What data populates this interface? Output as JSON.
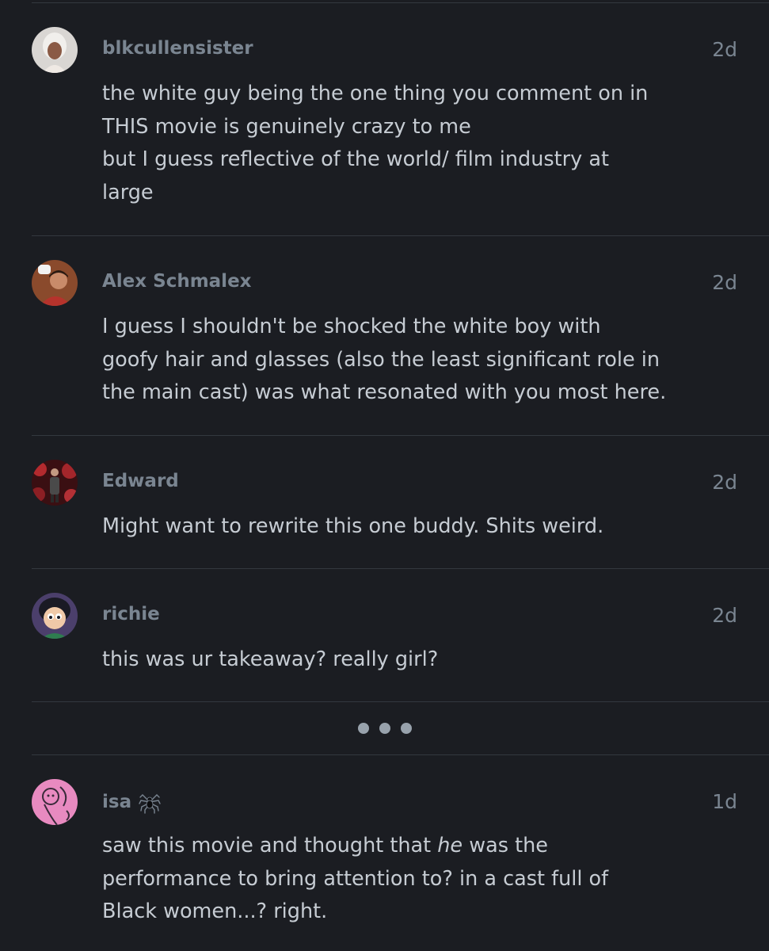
{
  "comments": [
    {
      "username": "blkcullensister",
      "time": "2d",
      "lines": [
        "the white guy being the one thing you comment on in",
        "THIS movie is genuinely crazy to me",
        "but I guess reflective of the world/ film industry at",
        "large"
      ]
    },
    {
      "username": "Alex Schmalex",
      "time": "2d",
      "lines": [
        "I guess I shouldn't be shocked the white boy with",
        "goofy hair and glasses (also the least significant role in",
        "the main cast) was what resonated with you most here."
      ]
    },
    {
      "username": "Edward",
      "time": "2d",
      "lines": [
        "Might want to rewrite this one buddy. Shits weird."
      ]
    },
    {
      "username": "richie",
      "time": "2d",
      "lines": [
        "this was ur takeaway? really girl?"
      ]
    },
    {
      "username": "isa",
      "username_icon": "spider-icon",
      "time": "1d",
      "lines": [
        "saw this movie and thought that ",
        "he",
        " was the",
        "performance to bring attention to? in a cast full of",
        "Black women...? right."
      ]
    }
  ],
  "more_button": {
    "icon": "ellipsis-icon"
  }
}
